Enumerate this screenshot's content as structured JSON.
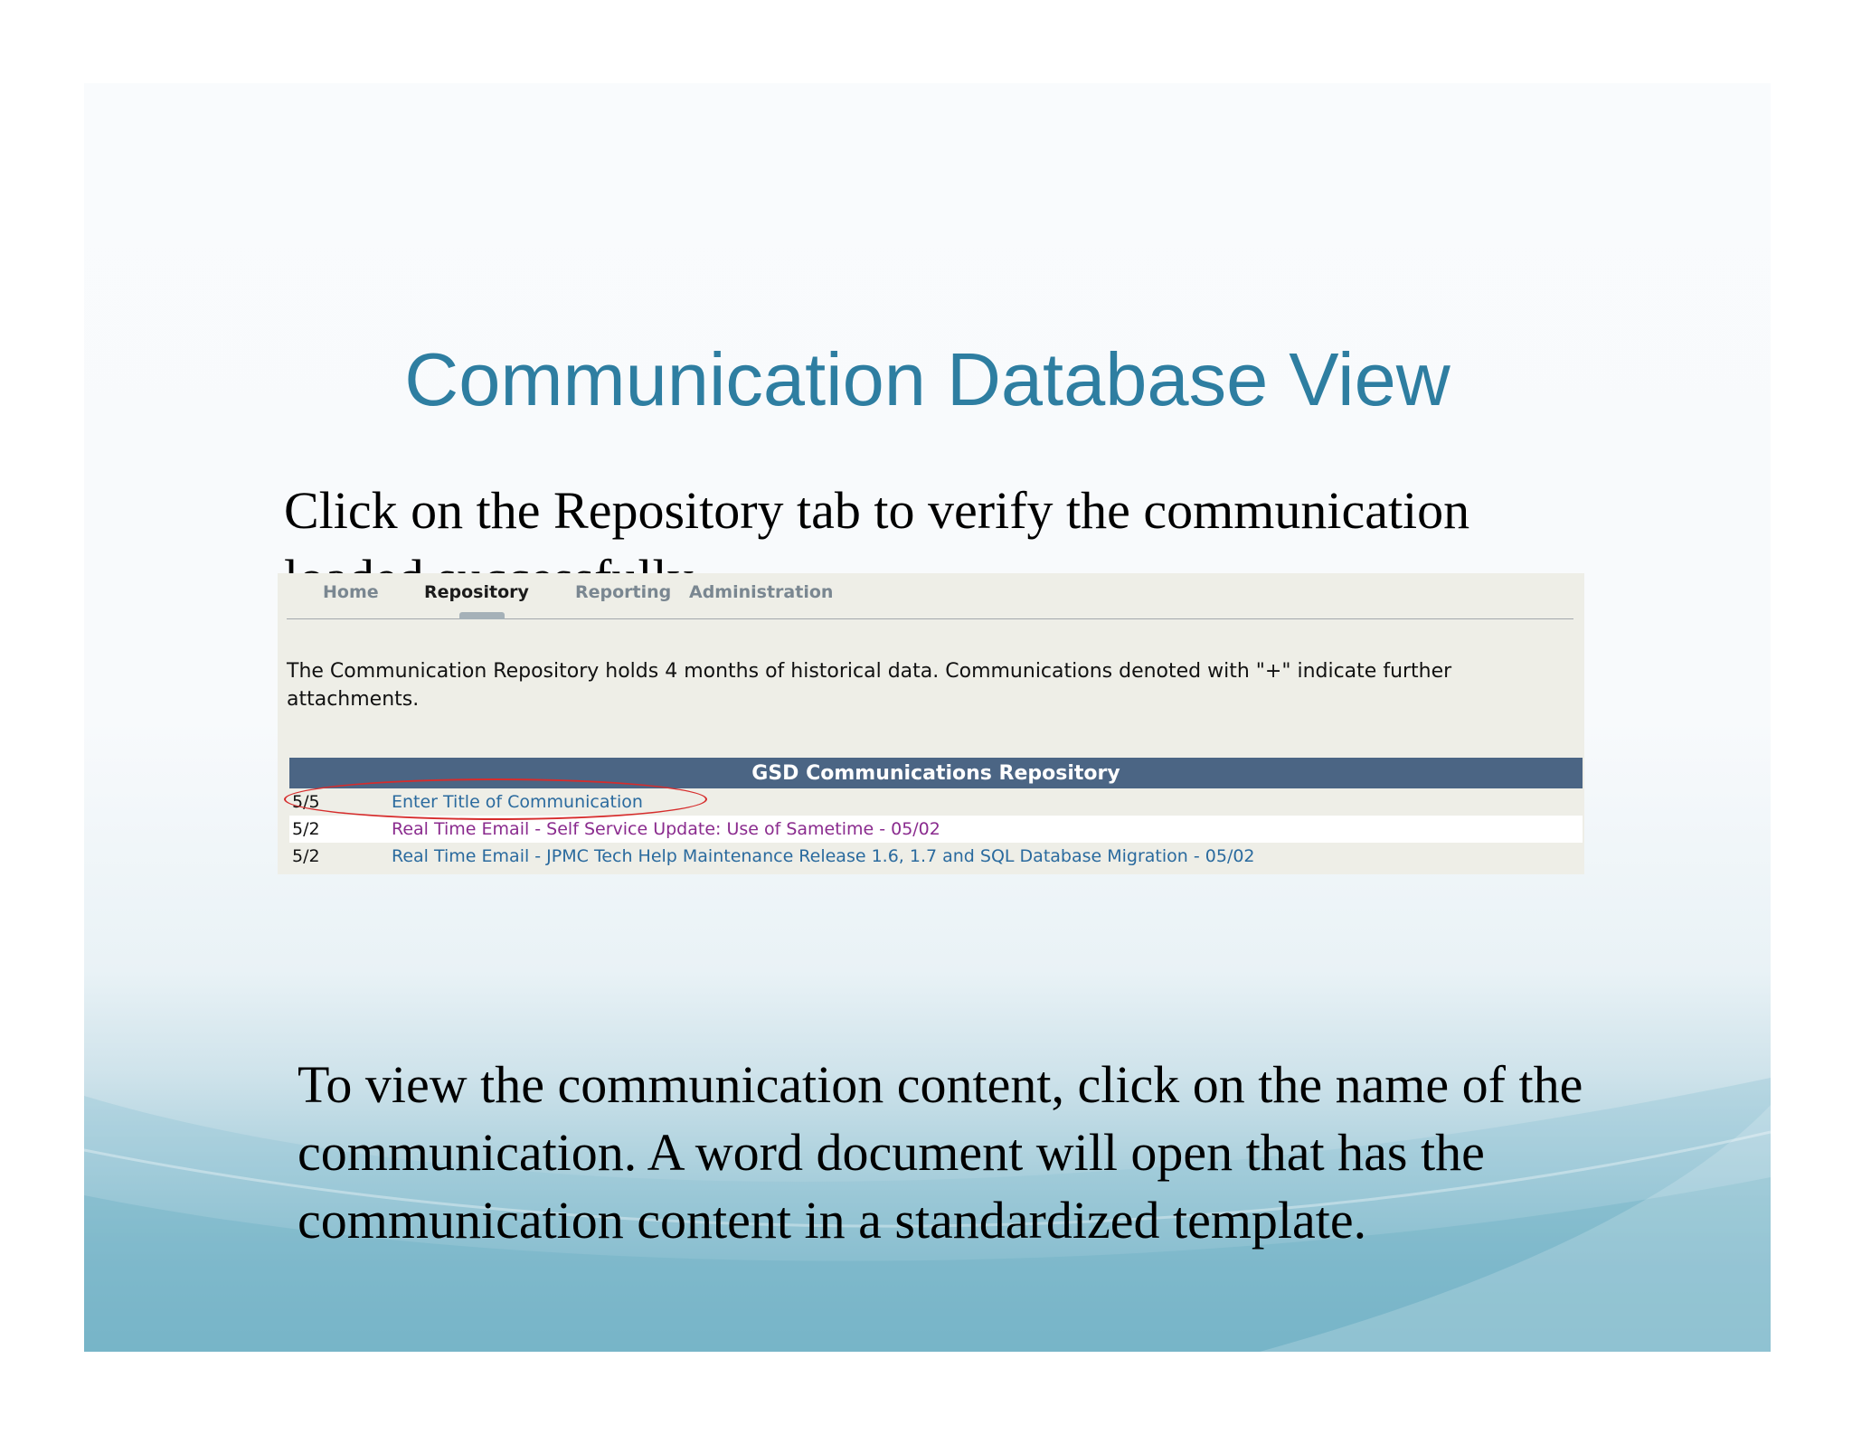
{
  "slide": {
    "title": "Communication Database View",
    "intro_text": "Click on the Repository tab to verify the communication loaded successfully.",
    "outro_text": "To view the communication content, click on the name of the communication.  A word document will open that has the communication content in a standardized template."
  },
  "app": {
    "tabs": [
      {
        "label": "Home",
        "active": false
      },
      {
        "label": "Repository",
        "active": true
      },
      {
        "label": "Reporting",
        "active": false
      },
      {
        "label": "Administration",
        "active": false
      }
    ],
    "notice": "The Communication Repository holds 4 months of historical data. Communications denoted with \"+\" indicate further attachments.",
    "table": {
      "header": "GSD Communications Repository",
      "rows": [
        {
          "date": "5/5",
          "name": "Enter Title of Communication"
        },
        {
          "date": "5/2",
          "name": "Real Time Email - Self Service Update: Use of Sametime - 05/02"
        },
        {
          "date": "5/2",
          "name": "Real Time Email - JPMC Tech Help Maintenance Release 1.6, 1.7 and SQL Database Migration - 05/02"
        }
      ]
    }
  },
  "colors": {
    "title": "#2e7ea1",
    "table_header": "#4b6584",
    "link": "#2a6a9e",
    "visited_link": "#8a2b8e",
    "highlight_oval": "#d62c2c"
  }
}
